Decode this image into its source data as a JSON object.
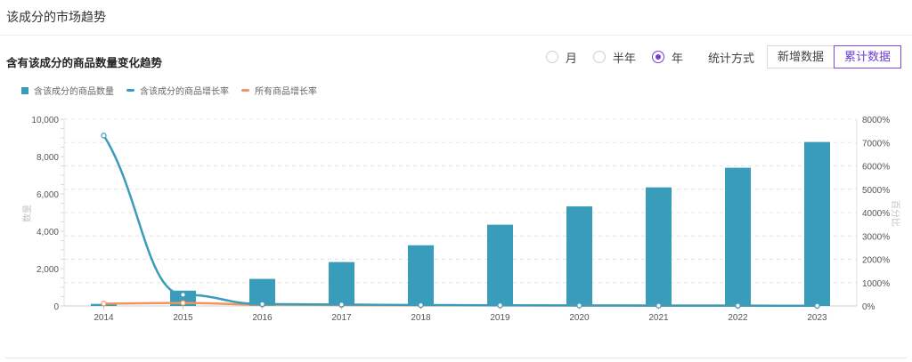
{
  "section": {
    "title": "该成分的市场趋势"
  },
  "chart_title": "含有该成分的商品数量变化趋势",
  "period": {
    "options": [
      {
        "label": "月",
        "checked": false
      },
      {
        "label": "半年",
        "checked": false
      },
      {
        "label": "年",
        "checked": true
      }
    ]
  },
  "stat_method": {
    "label": "统计方式",
    "options": [
      {
        "label": "新增数据",
        "active": false
      },
      {
        "label": "累计数据",
        "active": true
      }
    ]
  },
  "colors": {
    "accent": "#6f3fd8",
    "bar": "#3a9cbb",
    "line_product": "#3a9cbb",
    "line_all": "#f0955d"
  },
  "chart_data": {
    "type": "bar",
    "title": "含有该成分的商品数量变化趋势",
    "categories": [
      "2014",
      "2015",
      "2016",
      "2017",
      "2018",
      "2019",
      "2020",
      "2021",
      "2022",
      "2023"
    ],
    "ylabel": "数量",
    "y2label": "百分比",
    "ylim": [
      0,
      10000
    ],
    "y2lim": [
      0,
      8000
    ],
    "y_ticks": [
      "0",
      "2,000",
      "4,000",
      "6,000",
      "8,000",
      "10,000"
    ],
    "y2_ticks": [
      "0%",
      "1000%",
      "2000%",
      "3000%",
      "4000%",
      "5000%",
      "6000%",
      "7000%",
      "8000%"
    ],
    "grid": true,
    "legend_position": "top-left",
    "series": [
      {
        "name": "含该成分的商品数量",
        "type": "bar",
        "axis": "left",
        "values": [
          110,
          820,
          1450,
          2350,
          3250,
          4350,
          5330,
          6350,
          7400,
          8780
        ]
      },
      {
        "name": "含该成分的商品增长率",
        "type": "line",
        "axis": "right",
        "values": [
          7300,
          480,
          80,
          60,
          40,
          30,
          20,
          15,
          12,
          10
        ]
      },
      {
        "name": "所有商品增长率",
        "type": "line",
        "axis": "right",
        "values": [
          100,
          130,
          60,
          40,
          30,
          25,
          20,
          15,
          12,
          10
        ]
      }
    ]
  }
}
